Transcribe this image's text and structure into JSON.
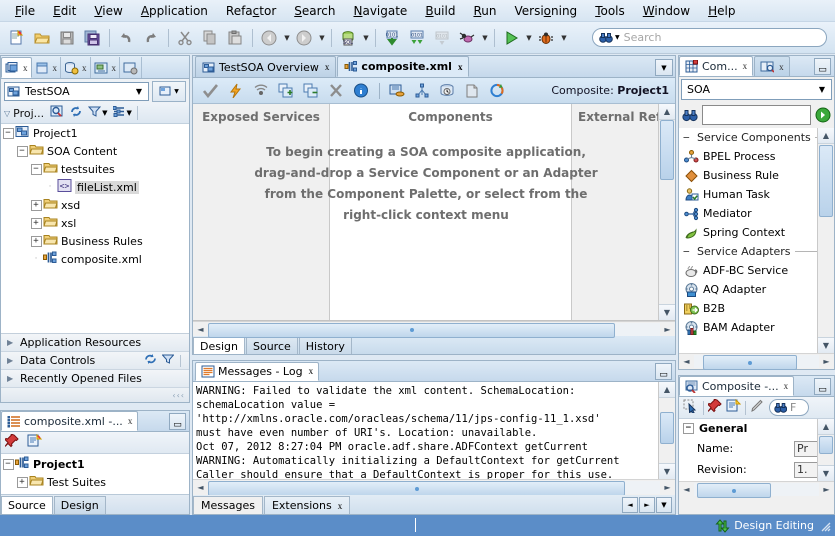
{
  "menu": {
    "items": [
      {
        "label": "File",
        "mnemonic": "F"
      },
      {
        "label": "Edit",
        "mnemonic": "E"
      },
      {
        "label": "View",
        "mnemonic": "V"
      },
      {
        "label": "Application",
        "mnemonic": "A"
      },
      {
        "label": "Refactor",
        "mnemonic": "c"
      },
      {
        "label": "Search",
        "mnemonic": "S"
      },
      {
        "label": "Navigate",
        "mnemonic": "N"
      },
      {
        "label": "Build",
        "mnemonic": "B"
      },
      {
        "label": "Run",
        "mnemonic": "R"
      },
      {
        "label": "Versioning",
        "mnemonic": "o"
      },
      {
        "label": "Tools",
        "mnemonic": "T"
      },
      {
        "label": "Window",
        "mnemonic": "W"
      },
      {
        "label": "Help",
        "mnemonic": "H"
      }
    ]
  },
  "toolbar": {
    "buttons": [
      {
        "name": "new-icon"
      },
      {
        "name": "open-icon"
      },
      {
        "name": "save-icon"
      },
      {
        "name": "save-all-icon"
      },
      {
        "name": "undo-icon"
      },
      {
        "name": "redo-icon"
      },
      {
        "name": "cut-icon"
      },
      {
        "name": "copy-icon"
      },
      {
        "name": "paste-icon"
      },
      {
        "name": "back-icon"
      },
      {
        "name": "forward-icon"
      },
      {
        "name": "sql-worksheet-icon"
      },
      {
        "name": "make-icon"
      },
      {
        "name": "rebuild-icon"
      },
      {
        "name": "deploy-icon"
      },
      {
        "name": "ant-icon"
      },
      {
        "name": "run-icon"
      },
      {
        "name": "debug-icon"
      }
    ],
    "search_placeholder": "Search",
    "search_value": ""
  },
  "navigator": {
    "tabs": [
      {
        "name": "applications-tab",
        "icon": "applications-icon",
        "active": true
      },
      {
        "name": "files-tab",
        "icon": "files-icon",
        "active": false
      },
      {
        "name": "database-tab",
        "icon": "database-icon",
        "active": false
      },
      {
        "name": "resource-tab",
        "icon": "resource-icon",
        "active": false
      },
      {
        "name": "more-tab",
        "icon": "connections-icon",
        "active": false
      }
    ],
    "application": "TestSOA",
    "projects_label": "Proj...",
    "tree": [
      {
        "label": "Project1",
        "depth": 0,
        "expander": "-",
        "icon": "project-icon",
        "selected": false
      },
      {
        "label": "SOA Content",
        "depth": 1,
        "expander": "-",
        "icon": "folder-icon",
        "selected": false
      },
      {
        "label": "testsuites",
        "depth": 2,
        "expander": "-",
        "icon": "folder-icon",
        "selected": false
      },
      {
        "label": "fileList.xml",
        "depth": 3,
        "expander": "",
        "icon": "xml-icon",
        "selected": true
      },
      {
        "label": "xsd",
        "depth": 2,
        "expander": "+",
        "icon": "folder-icon",
        "selected": false
      },
      {
        "label": "xsl",
        "depth": 2,
        "expander": "+",
        "icon": "folder-icon",
        "selected": false
      },
      {
        "label": "Business Rules",
        "depth": 2,
        "expander": "+",
        "icon": "folder-icon",
        "selected": false
      },
      {
        "label": "composite.xml",
        "depth": 2,
        "expander": "",
        "icon": "composite-icon",
        "selected": false
      }
    ],
    "accordions": [
      {
        "label": "Application Resources",
        "has_tools": false
      },
      {
        "label": "Data Controls",
        "has_tools": true
      },
      {
        "label": "Recently Opened Files",
        "has_tools": false
      }
    ]
  },
  "structure": {
    "tab_label": "composite.xml -...",
    "tree": [
      {
        "label": "Project1",
        "depth": 0,
        "expander": "-",
        "icon": "composite-icon",
        "bold": true
      },
      {
        "label": "Test Suites",
        "depth": 1,
        "expander": "+",
        "icon": "folder-icon",
        "bold": false
      }
    ],
    "bottom_tabs": [
      {
        "label": "Source",
        "active": true
      },
      {
        "label": "Design",
        "active": false
      }
    ]
  },
  "editor": {
    "tabs": [
      {
        "label": "TestSOA Overview",
        "icon": "overview-icon",
        "active": false
      },
      {
        "label": "composite.xml",
        "icon": "composite-icon",
        "active": true
      }
    ],
    "toolbar_icons": [
      "validate-icon",
      "refresh-icon",
      "wsdl-icon",
      "add-icon",
      "remove-icon",
      "delete-icon",
      "info-icon",
      "db-icon",
      "topology-icon",
      "history-icon",
      "package-icon",
      "sync-icon"
    ],
    "composite_label": "Composite:",
    "composite_name": "Project1",
    "lanes": [
      {
        "title": "Exposed Services"
      },
      {
        "title": "Components"
      },
      {
        "title": "External Ref"
      }
    ],
    "hint_lines": [
      "To begin creating a SOA composite application,",
      "drag-and-drop a Service Component or an Adapter",
      "from the Component Palette, or select from the",
      "right-click context menu"
    ],
    "bottom_tabs": [
      {
        "label": "Design",
        "active": true
      },
      {
        "label": "Source",
        "active": false
      },
      {
        "label": "History",
        "active": false
      }
    ]
  },
  "log": {
    "tab_label": "Messages - Log",
    "text": "WARNING: Failed to validate the xml content. SchemaLocation:\nschemaLocation value =\n'http://xmlns.oracle.com/oracleas/schema/11/jps-config-11_1.xsd'\nmust have even number of URI's. Location: unavailable.\nOct 07, 2012 8:27:04 PM oracle.adf.share.ADFContext getCurrent\nWARNING: Automatically initializing a DefaultContext for getCurrent\nCaller should ensure that a DefaultContext is proper for this use.",
    "bottom_tabs": [
      {
        "label": "Messages",
        "active": true,
        "closable": false
      },
      {
        "label": "Extensions",
        "active": false,
        "closable": true
      }
    ]
  },
  "palette": {
    "tabs": [
      {
        "label": "Com...",
        "icon": "palette-icon",
        "active": true
      },
      {
        "label": "",
        "icon": "resource-catalog-icon",
        "active": false
      }
    ],
    "selected_category": "SOA",
    "search_value": "",
    "groups": [
      {
        "title": "Service Components",
        "items": [
          {
            "label": "BPEL Process",
            "icon": "bpel-icon"
          },
          {
            "label": "Business Rule",
            "icon": "business-rule-icon"
          },
          {
            "label": "Human Task",
            "icon": "human-task-icon"
          },
          {
            "label": "Mediator",
            "icon": "mediator-icon"
          },
          {
            "label": "Spring Context",
            "icon": "spring-icon"
          }
        ]
      },
      {
        "title": "Service Adapters",
        "items": [
          {
            "label": "ADF-BC Service",
            "icon": "adfbc-icon"
          },
          {
            "label": "AQ Adapter",
            "icon": "aq-icon"
          },
          {
            "label": "B2B",
            "icon": "b2b-icon"
          },
          {
            "label": "BAM Adapter",
            "icon": "bam-icon"
          }
        ]
      }
    ]
  },
  "inspector": {
    "tab_label": "Composite -...",
    "find_label": "F",
    "group_label": "General",
    "rows": [
      {
        "label": "Name:",
        "value": "Pr"
      },
      {
        "label": "Revision:",
        "value": "1."
      }
    ]
  },
  "status": {
    "mode": "Design Editing"
  },
  "colors": {
    "accent": "#5b8dc8",
    "panel_bg": "#f0f0f0",
    "tab_active": "#ffffff",
    "hint_text": "#6e6e6e"
  }
}
